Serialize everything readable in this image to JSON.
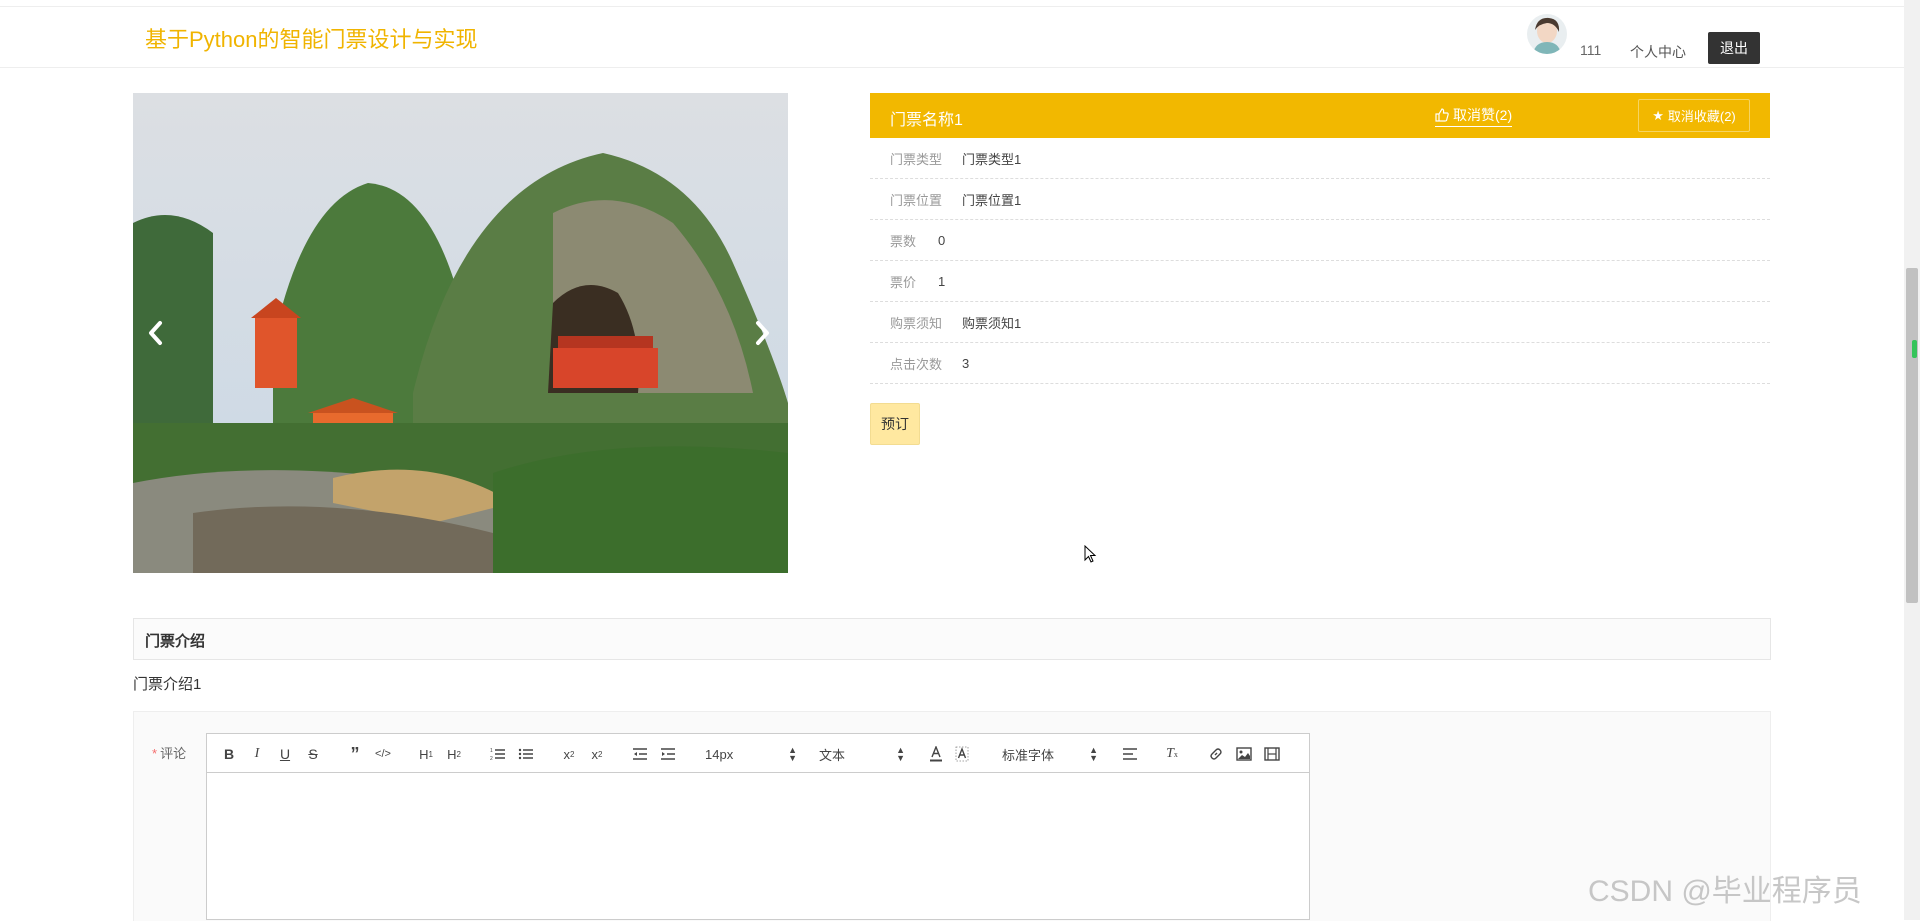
{
  "header": {
    "title": "基于Python的智能门票设计与实现",
    "username": "111",
    "profile_label": "个人中心",
    "logout_label": "退出"
  },
  "ticket": {
    "name": "门票名称1",
    "like_label": "取消赞(2)",
    "favorite_label": "取消收藏(2)",
    "fields": [
      {
        "label": "门票类型",
        "value": "门票类型1"
      },
      {
        "label": "门票位置",
        "value": "门票位置1"
      },
      {
        "label": "票数",
        "value": "0"
      },
      {
        "label": "票价",
        "value": "1"
      },
      {
        "label": "购票须知",
        "value": "购票须知1"
      },
      {
        "label": "点击次数",
        "value": "3"
      }
    ],
    "book_label": "预订"
  },
  "intro": {
    "title": "门票介绍",
    "content": "门票介绍1"
  },
  "comment": {
    "label": "评论",
    "required_mark": "*",
    "font_size": "14px",
    "text_type": "文本",
    "font_family": "标准字体"
  },
  "watermark": "CSDN @毕业程序员",
  "colors": {
    "brand": "#f2b800",
    "title": "#f0b400",
    "book_button": "#ffe8a0"
  }
}
